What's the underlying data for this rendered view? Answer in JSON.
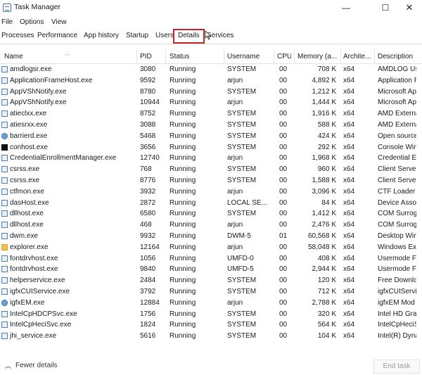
{
  "window": {
    "title": "Task Manager"
  },
  "menu": [
    "File",
    "Options",
    "View"
  ],
  "tabs": [
    "Processes",
    "Performance",
    "App history",
    "Startup",
    "Users",
    "Details",
    "Services"
  ],
  "columns": [
    "Name",
    "PID",
    "Status",
    "Username",
    "CPU",
    "Memory (a...",
    "Archite...",
    "Description"
  ],
  "rows": [
    {
      "name": "amdlogsr.exe",
      "pid": "3080",
      "status": "Running",
      "user": "SYSTEM",
      "cpu": "00",
      "mem": "708 K",
      "arch": "x64",
      "desc": "AMDLOG Us"
    },
    {
      "name": "ApplicationFrameHost.exe",
      "pid": "9592",
      "status": "Running",
      "user": "arjun",
      "cpu": "00",
      "mem": "4,892 K",
      "arch": "x64",
      "desc": "Application F"
    },
    {
      "name": "AppVShNotify.exe",
      "pid": "8780",
      "status": "Running",
      "user": "SYSTEM",
      "cpu": "00",
      "mem": "1,212 K",
      "arch": "x64",
      "desc": "Microsoft Ap"
    },
    {
      "name": "AppVShNotify.exe",
      "pid": "10944",
      "status": "Running",
      "user": "arjun",
      "cpu": "00",
      "mem": "1,444 K",
      "arch": "x64",
      "desc": "Microsoft Ap"
    },
    {
      "name": "atieclxx.exe",
      "pid": "8752",
      "status": "Running",
      "user": "SYSTEM",
      "cpu": "00",
      "mem": "1,916 K",
      "arch": "x64",
      "desc": "AMD Externa"
    },
    {
      "name": "atiesrxx.exe",
      "pid": "3088",
      "status": "Running",
      "user": "SYSTEM",
      "cpu": "00",
      "mem": "588 K",
      "arch": "x64",
      "desc": "AMD Externa"
    },
    {
      "name": "barrierd.exe",
      "pid": "5468",
      "status": "Running",
      "user": "SYSTEM",
      "cpu": "00",
      "mem": "424 K",
      "arch": "x64",
      "desc": "Open source"
    },
    {
      "name": "conhost.exe",
      "pid": "3656",
      "status": "Running",
      "user": "SYSTEM",
      "cpu": "00",
      "mem": "292 K",
      "arch": "x64",
      "desc": "Console Win"
    },
    {
      "name": "CredentialEnrollmentManager.exe",
      "pid": "12740",
      "status": "Running",
      "user": "arjun",
      "cpu": "00",
      "mem": "1,968 K",
      "arch": "x64",
      "desc": "Credential Er"
    },
    {
      "name": "csrss.exe",
      "pid": "768",
      "status": "Running",
      "user": "SYSTEM",
      "cpu": "00",
      "mem": "960 K",
      "arch": "x64",
      "desc": "Client Server"
    },
    {
      "name": "csrss.exe",
      "pid": "8776",
      "status": "Running",
      "user": "SYSTEM",
      "cpu": "00",
      "mem": "1,588 K",
      "arch": "x64",
      "desc": "Client Server"
    },
    {
      "name": "ctfmon.exe",
      "pid": "3932",
      "status": "Running",
      "user": "arjun",
      "cpu": "00",
      "mem": "3,096 K",
      "arch": "x64",
      "desc": "CTF Loader"
    },
    {
      "name": "dasHost.exe",
      "pid": "2872",
      "status": "Running",
      "user": "LOCAL SE...",
      "cpu": "00",
      "mem": "84 K",
      "arch": "x64",
      "desc": "Device Assoc"
    },
    {
      "name": "dllhost.exe",
      "pid": "6580",
      "status": "Running",
      "user": "SYSTEM",
      "cpu": "00",
      "mem": "1,412 K",
      "arch": "x64",
      "desc": "COM Surrog"
    },
    {
      "name": "dllhost.exe",
      "pid": "468",
      "status": "Running",
      "user": "arjun",
      "cpu": "00",
      "mem": "2,476 K",
      "arch": "x64",
      "desc": "COM Surrog"
    },
    {
      "name": "dwm.exe",
      "pid": "9932",
      "status": "Running",
      "user": "DWM-5",
      "cpu": "01",
      "mem": "60,568 K",
      "arch": "x64",
      "desc": "Desktop Win"
    },
    {
      "name": "explorer.exe",
      "pid": "12164",
      "status": "Running",
      "user": "arjun",
      "cpu": "00",
      "mem": "58,048 K",
      "arch": "x64",
      "desc": "Windows Exp"
    },
    {
      "name": "fontdrvhost.exe",
      "pid": "1056",
      "status": "Running",
      "user": "UMFD-0",
      "cpu": "00",
      "mem": "408 K",
      "arch": "x64",
      "desc": "Usermode Fo"
    },
    {
      "name": "fontdrvhost.exe",
      "pid": "9840",
      "status": "Running",
      "user": "UMFD-5",
      "cpu": "00",
      "mem": "2,944 K",
      "arch": "x64",
      "desc": "Usermode Fo"
    },
    {
      "name": "helperservice.exe",
      "pid": "2484",
      "status": "Running",
      "user": "SYSTEM",
      "cpu": "00",
      "mem": "120 K",
      "arch": "x64",
      "desc": "Free Downlo"
    },
    {
      "name": "igfxCUIService.exe",
      "pid": "3792",
      "status": "Running",
      "user": "SYSTEM",
      "cpu": "00",
      "mem": "712 K",
      "arch": "x64",
      "desc": "igfxCUIServic"
    },
    {
      "name": "igfxEM.exe",
      "pid": "12884",
      "status": "Running",
      "user": "arjun",
      "cpu": "00",
      "mem": "2,788 K",
      "arch": "x64",
      "desc": "igfxEM Mod"
    },
    {
      "name": "IntelCpHDCPSvc.exe",
      "pid": "1756",
      "status": "Running",
      "user": "SYSTEM",
      "cpu": "00",
      "mem": "320 K",
      "arch": "x64",
      "desc": "Intel HD Gra"
    },
    {
      "name": "IntelCpHeciSvc.exe",
      "pid": "1824",
      "status": "Running",
      "user": "SYSTEM",
      "cpu": "00",
      "mem": "564 K",
      "arch": "x64",
      "desc": "IntelCpHeciS"
    },
    {
      "name": "jhi_service.exe",
      "pid": "5616",
      "status": "Running",
      "user": "SYSTEM",
      "cpu": "00",
      "mem": "104 K",
      "arch": "x64",
      "desc": "Intel(R) Dyna"
    }
  ],
  "footer": {
    "fewer_details": "Fewer details",
    "end_task": "End task"
  },
  "colors": {
    "active_tab_border": "#c0272d"
  }
}
